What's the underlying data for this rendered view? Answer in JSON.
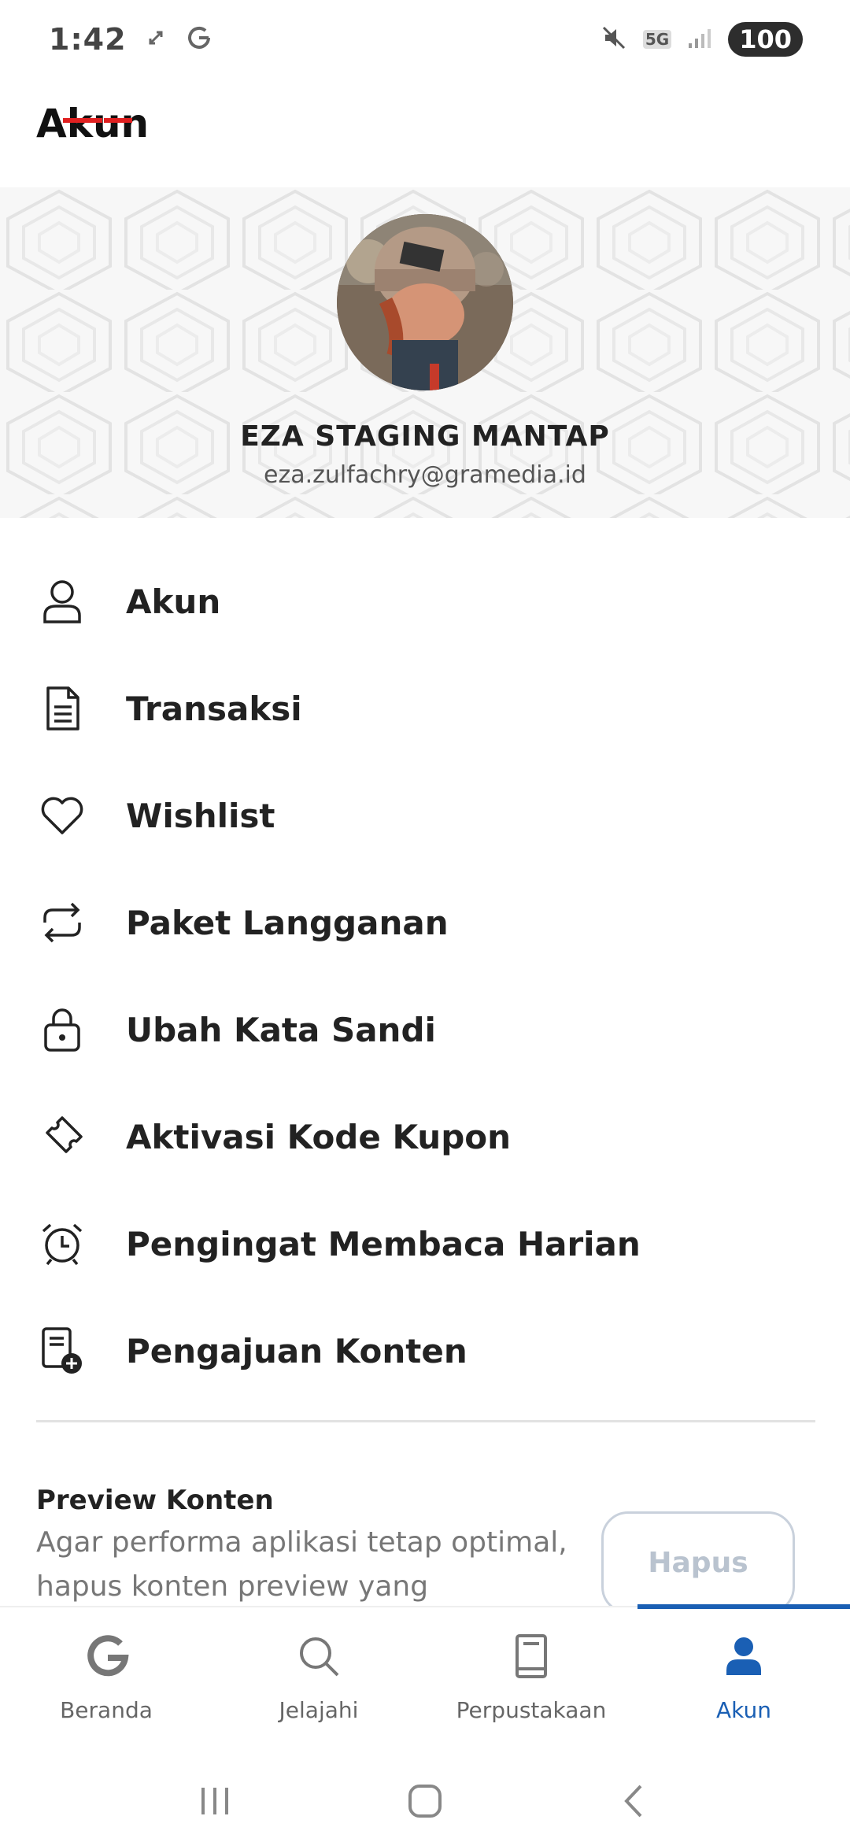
{
  "status_bar": {
    "time": "1:42",
    "network": "5G",
    "battery": "100"
  },
  "page": {
    "title": "Akun"
  },
  "profile": {
    "name": "EZA STAGING MANTAP",
    "email": "eza.zulfachry@gramedia.id"
  },
  "menu": {
    "items": [
      {
        "label": "Akun",
        "icon": "user-icon"
      },
      {
        "label": "Transaksi",
        "icon": "receipt-icon"
      },
      {
        "label": "Wishlist",
        "icon": "heart-icon"
      },
      {
        "label": "Paket Langganan",
        "icon": "repeat-icon"
      },
      {
        "label": "Ubah Kata Sandi",
        "icon": "lock-icon"
      },
      {
        "label": "Aktivasi Kode Kupon",
        "icon": "ticket-icon"
      },
      {
        "label": "Pengingat Membaca Harian",
        "icon": "alarm-clock-icon"
      },
      {
        "label": "Pengajuan Konten",
        "icon": "document-add-icon"
      }
    ]
  },
  "preview": {
    "title": "Preview Konten",
    "description": "Agar performa aplikasi tetap optimal, hapus konten preview yang tersimpan",
    "button_label": "Hapus"
  },
  "bottom_nav": {
    "active": "Akun",
    "items": [
      {
        "label": "Beranda",
        "icon": "gramedia-logo-icon"
      },
      {
        "label": "Jelajahi",
        "icon": "search-icon"
      },
      {
        "label": "Perpustakaan",
        "icon": "book-icon"
      },
      {
        "label": "Akun",
        "icon": "user-filled-icon"
      }
    ]
  },
  "colors": {
    "accent": "#1a5fb4",
    "text": "#222222",
    "muted": "#777777",
    "button_border": "#c9d1dc"
  }
}
